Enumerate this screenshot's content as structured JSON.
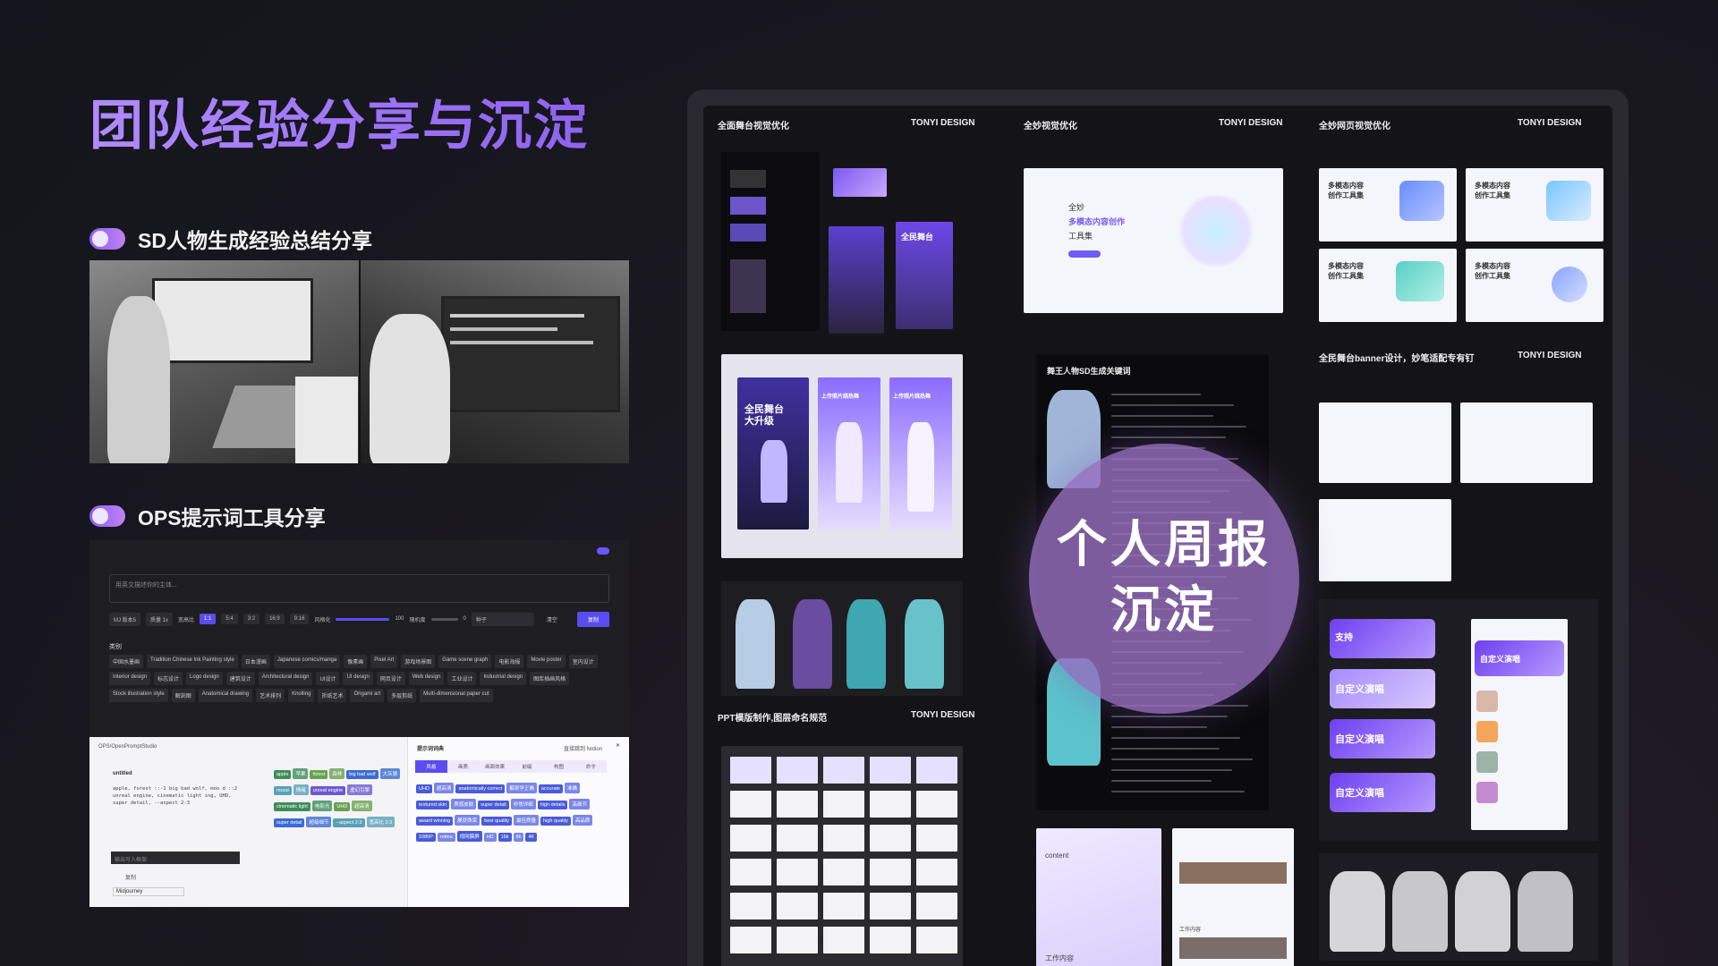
{
  "page": {
    "title": "团队经验分享与沉淀",
    "sections": [
      {
        "id": "sd",
        "label": "SD人物生成经验总结分享"
      },
      {
        "id": "ops",
        "label": "OPS提示词工具分享"
      }
    ]
  },
  "ops_tool": {
    "prompt_placeholder": "用英文描述你的主体...",
    "controls": [
      "MJ 版本5",
      "质量 1x",
      "宽高比",
      "1:1",
      "5:4",
      "3:2",
      "16:9",
      "9:16",
      "风格化",
      "100",
      "随机度",
      "0",
      "种子"
    ],
    "clear_label": "清空",
    "copy_label": "复制",
    "category_label": "类别",
    "tags": [
      "中国水墨画",
      "Tradition Chinese Ink Painting style",
      "日本漫画",
      "Japanese comics/manga",
      "像素画",
      "Pixel Art",
      "游戏场景图",
      "Game scene graph",
      "电影海报",
      "Movie poster",
      "室内设计",
      "Interior design",
      "标志设计",
      "Logo design",
      "建筑设计",
      "Architectural design",
      "UI设计",
      "UI design",
      "网页设计",
      "Web design",
      "工业设计",
      "Industrial design",
      "图库插画风格",
      "Stock illustration style",
      "解剖图",
      "Anatomical drawing",
      "艺术排列",
      "Knolling",
      "折纸艺术",
      "Origami art",
      "多层剪纸",
      "Multi-dimensional paper cut"
    ],
    "studio": {
      "repo": "OPS/OpenPromptStudio",
      "doc_title": "untitled",
      "doc_text": "apple, forest ::-1 big bad wolf, moo d ::2 unreal engine, cinematic light ing, UHD, super detail, --aspect 2:3",
      "input_placeholder": "输出写入框架",
      "copy_label": "复制",
      "model": "Midjourney",
      "left_chips": [
        "apple",
        "苹果",
        "forest",
        "森林",
        "big bad wolf",
        "大灰狼",
        "mood",
        "情绪",
        "unreal engine",
        "虚幻引擎",
        "cinematic light",
        "电影光",
        "UHD",
        "超高清",
        "super detail",
        "超级细节",
        "--aspect 2:3",
        "宽高比 2:3"
      ],
      "dict_title": "提示词词典",
      "notion_label": "直接跳到 Notion",
      "dict_tabs": [
        "风格",
        "画质",
        "画面效果",
        "前缀",
        "构图",
        "命令"
      ],
      "dict_chips": [
        "UHD",
        "超高清",
        "anatomically correct",
        "解剖学正确",
        "accurate",
        "准确",
        "textured skin",
        "质感皮肤",
        "super detail",
        "非常详细",
        "high details",
        "高细节",
        "award winning",
        "屡获殊荣",
        "best quality",
        "最佳质量",
        "high quality",
        "高品质",
        "1080P",
        "retina",
        "视网膜屏",
        "HD",
        "16k",
        "8k",
        "4K"
      ]
    }
  },
  "showcase": {
    "brand": "TONYI DESIGN",
    "columns": [
      {
        "title": "全面舞台视觉优化"
      },
      {
        "title": "全妙视觉优化"
      },
      {
        "title": "全妙网页视觉优化"
      }
    ],
    "ppt_title": "PPT模版制作,图层命名规范",
    "banner_title": "全民舞台banner设计，妙笔适配专有钉",
    "sd_keyword_title": "舞王人物SD生成关键词",
    "quanmiao_hero": [
      "全妙",
      "多模态内容创作",
      "工具集"
    ],
    "card_text_1": "多模态内容",
    "card_text_2": "创作工具集",
    "app_banner_1": "全民舞台",
    "app_banner_2": "大升级",
    "dance_banner": "上传照片跳热舞",
    "custom_sing": "自定义演唱",
    "support_text": "支持",
    "ppt_work": "工作内容",
    "content_label": "content"
  },
  "overlay": {
    "line1": "个人周报",
    "line2": "沉淀"
  },
  "colors": {
    "accent": "#8e62f0",
    "title_gradient_start": "#b08bff",
    "overlay": "#966ebe",
    "copy_button": "#5a4cf0"
  }
}
